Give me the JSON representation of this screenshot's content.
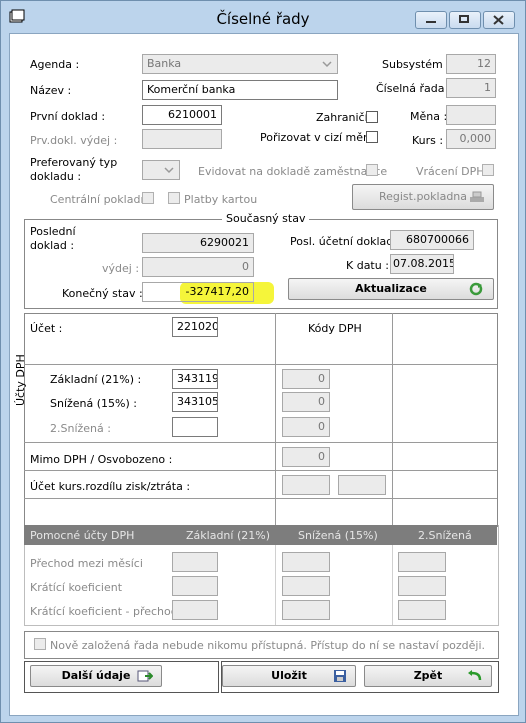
{
  "window": {
    "title": "Číselné řady"
  },
  "top": {
    "agenda_label": "Agenda :",
    "agenda_value": "Banka",
    "nazev_label": "Název :",
    "nazev_value": "Komerční banka",
    "prvni_doklad_label": "První doklad :",
    "prvni_doklad_value": "6210001",
    "prv_dokl_vydej_label": "Prv.dokl. výdej :",
    "preferovany_label_1": "Preferovaný typ",
    "preferovany_label_2": "dokladu :",
    "subsystem_label": "Subsystém :",
    "subsystem_value": "12",
    "ciselna_rada_label": "Číselná řada :",
    "ciselna_rada_value": "1",
    "zahranicni_label": "Zahraničí",
    "porizovat_label": "Pořizovat v cizí měně",
    "mena_label": "Měna :",
    "kurs_label": "Kurs :",
    "kurs_value": "0,000",
    "evidovat_label": "Evidovat na dokladě zaměstnance",
    "vraceni_dph_label": "Vrácení DPH",
    "centralni_label": "Centrální pokladna",
    "platby_label": "Platby kartou",
    "regist_button": "Regist.pokladna"
  },
  "soucasny": {
    "legend": "Současný stav",
    "posledni_label_1": "Poslední",
    "posledni_label_2": "doklad :",
    "posledni_value": "6290021",
    "vydej_label": "výdej :",
    "vydej_value": "0",
    "konecny_label": "Konečný stav :",
    "konecny_value": "-327417,20",
    "posl_ucetni_label": "Posl. účetní doklad :",
    "posl_ucetni_value": "680700066",
    "k_datu_label": "K datu :",
    "k_datu_value": "07.08.2015",
    "aktualizace_button": "Aktualizace"
  },
  "ucty": {
    "ucet_label": "Účet :",
    "ucet_value": "221020",
    "kody_dph_label": "Kódy DPH",
    "ucty_dph_vertical": "Účty DPH",
    "zakladni_label": "Základní (21%) :",
    "zakladni_value": "343119",
    "zakladni_kod": "0",
    "snizena_label": "Snížená (15%) :",
    "snizena_value": "343105",
    "snizena_kod": "0",
    "snizena2_label": "2.Snížená :",
    "snizena2_kod": "0",
    "mimo_label": "Mimo DPH / Osvobozeno :",
    "mimo_kod": "0",
    "kurs_rozdil_label": "Účet kurs.rozdílu zisk/ztráta :"
  },
  "pomocne": {
    "header": [
      "Pomocné účty DPH",
      "Základní (21%)",
      "Snížená (15%)",
      "2.Snížená"
    ],
    "rows": [
      "Přechod mezi měsíci",
      "Krátící koeficient",
      "Krátící koeficient - přechod"
    ]
  },
  "footer": {
    "note": "Nově založená řada nebude nikomu přístupná. Přístup do ní se nastaví později.",
    "dalsi_button": "Další údaje",
    "ulozit_button": "Uložit",
    "zpet_button": "Zpět"
  },
  "colors": {
    "highlight": "#f5f53a",
    "header_bar": "#7d7d7d"
  }
}
